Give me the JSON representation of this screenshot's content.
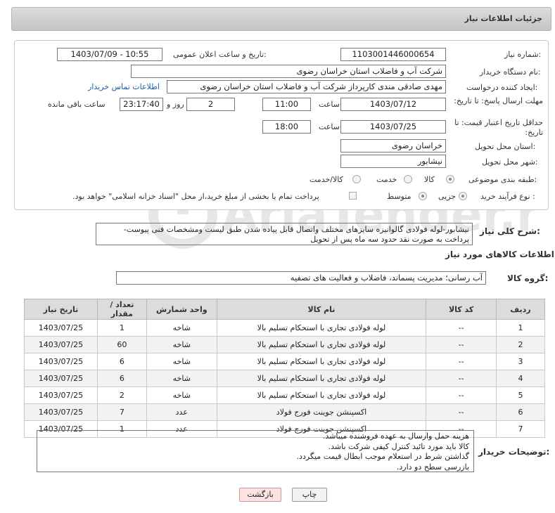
{
  "header": {
    "title": "جزئیات اطلاعات نیاز"
  },
  "fields": {
    "need_number_label": "شماره نیاز:",
    "need_number": "1103001446000654",
    "announce_label": "تاریخ و ساعت اعلان عمومی:",
    "announce_value": "1403/07/09 - 10:55",
    "buyer_org_label": "نام دستگاه خریدار:",
    "buyer_org": "شرکت آب و فاضلاب استان خراسان رضوی",
    "creator_label": "ایجاد کننده درخواست:",
    "creator": "مهدی صادقی مندی کارپرداز شرکت آب و فاضلاب استان خراسان رضوی",
    "contact_link": "اطلاعات تماس خریدار",
    "reply_deadline_label": "مهلت ارسال پاسخ: تا تاریخ:",
    "reply_date": "1403/07/12",
    "hour_label": "ساعت",
    "reply_time": "11:00",
    "days_value": "2",
    "days_label": "روز و",
    "remaining_time": "23:17:40",
    "remaining_label": "ساعت باقی مانده",
    "validity_label": "حداقل تاریخ اعتبار قیمت: تا تاریخ:",
    "validity_date": "1403/07/25",
    "validity_time": "18:00",
    "province_label": "استان محل تحویل:",
    "province": "خراسان رضوی",
    "city_label": "شهر محل تحویل:",
    "city": "نیشابور",
    "category_label": "طبقه بندی موضوعی:",
    "category_options": [
      "کالا",
      "خدمت",
      "کالا/خدمت"
    ],
    "process_label": "نوع فرآیند خرید :",
    "process_options": [
      "جزیی",
      "متوسط"
    ],
    "payment_text": "پرداخت تمام یا بخشی از مبلغ خرید،از محل \"اسناد خزانه اسلامی\" خواهد بود."
  },
  "general_desc": {
    "label": "شرح کلی نیاز:",
    "text": "نیشابور-لوله فولادی گالوانیزه سایزهای مختلف واتصال قابل پیاده شدن طبق لیست ومشخصات فنی پیوست- پرداخت به صورت نقد حدود سه ماه پس از تحویل"
  },
  "goods_section": {
    "title": "اطلاعات کالاهای مورد نیاز",
    "group_label": "گروه کالا:",
    "group_value": "آب رسانی؛ مدیریت پسماند، فاضلاب و فعالیت های تصفیه"
  },
  "table": {
    "headers": [
      "ردیف",
      "کد کالا",
      "نام کالا",
      "واحد شمارش",
      "تعداد / مقدار",
      "تاریخ نیاز"
    ],
    "rows": [
      [
        "1",
        "--",
        "لوله فولادی تجاری با استحکام تسلیم بالا",
        "شاخه",
        "1",
        "1403/07/25"
      ],
      [
        "2",
        "--",
        "لوله فولادی تجاری با استحکام تسلیم بالا",
        "شاخه",
        "60",
        "1403/07/25"
      ],
      [
        "3",
        "--",
        "لوله فولادی تجاری با استحکام تسلیم بالا",
        "شاخه",
        "6",
        "1403/07/25"
      ],
      [
        "4",
        "--",
        "لوله فولادی تجاری با استحکام تسلیم بالا",
        "شاخه",
        "6",
        "1403/07/25"
      ],
      [
        "5",
        "--",
        "لوله فولادی تجاری با استحکام تسلیم بالا",
        "شاخه",
        "2",
        "1403/07/25"
      ],
      [
        "6",
        "--",
        "اکسپنشن جوینت فورج فولاد",
        "عدد",
        "7",
        "1403/07/25"
      ],
      [
        "7",
        "--",
        "اکسپنشن جوینت فورج فولاد",
        "عدد",
        "1",
        "1403/07/25"
      ]
    ]
  },
  "buyer_notes": {
    "label": "توضیحات خریدار:",
    "lines": [
      "هزینه حمل وارسال به عهده فروشنده میباشد.",
      "کالا باید مورد تائید کنترل کیفی شرکت باشد.",
      "گذاشتن شرط در استعلام موجب ابطال قیمت میگردد.",
      "بازرسی سطح دو دارد."
    ]
  },
  "buttons": {
    "print": "چاپ",
    "back": "بازگشت"
  },
  "watermark": {
    "text": "AriaTender.net"
  }
}
